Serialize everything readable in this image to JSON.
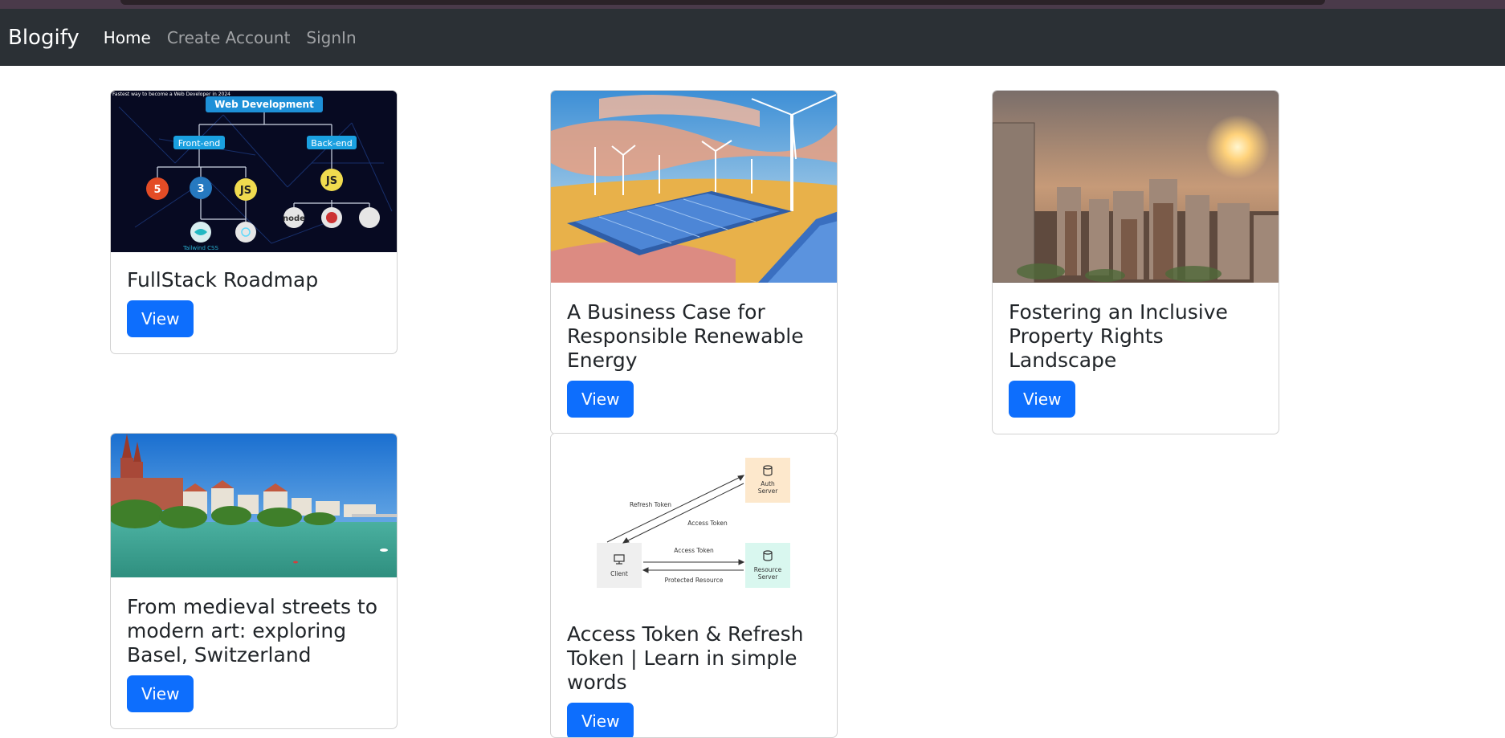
{
  "navbar": {
    "brand": "Blogify",
    "links": [
      {
        "label": "Home",
        "active": true
      },
      {
        "label": "Create Account",
        "active": false
      },
      {
        "label": "SignIn",
        "active": false
      }
    ]
  },
  "colors": {
    "navbar_bg": "#2b3035",
    "button_bg": "#0d6efd"
  },
  "cards": [
    {
      "title": "FullStack Roadmap",
      "button": "View",
      "image": {
        "top_caption": "Fastest way to become a Web Developer in 2024",
        "banner": "Web Development",
        "left_branch": "Front-end",
        "right_branch": "Back-end",
        "node_js": "JS",
        "node_css": "3",
        "node_html": "5",
        "node_backend_js": "JS",
        "node_node": "node",
        "footer": "Tailwind CSS"
      }
    },
    {
      "title": "A Business Case for Responsible Renewable Energy",
      "button": "View"
    },
    {
      "title": "Fostering an Inclusive Property Rights Landscape",
      "button": "View"
    },
    {
      "title": "From medieval streets to modern art: exploring Basel, Switzerland",
      "button": "View"
    },
    {
      "title": "Access Token & Refresh Token | Learn in simple words",
      "button": "View",
      "image": {
        "refresh_token": "Refresh Token",
        "access_token_1": "Access Token",
        "access_token_2": "Access Token",
        "protected_resource": "Protected Resource",
        "client": "Client",
        "auth_server_1": "Auth",
        "auth_server_2": "Server",
        "resource_server_1": "Resource",
        "resource_server_2": "Server"
      }
    }
  ]
}
